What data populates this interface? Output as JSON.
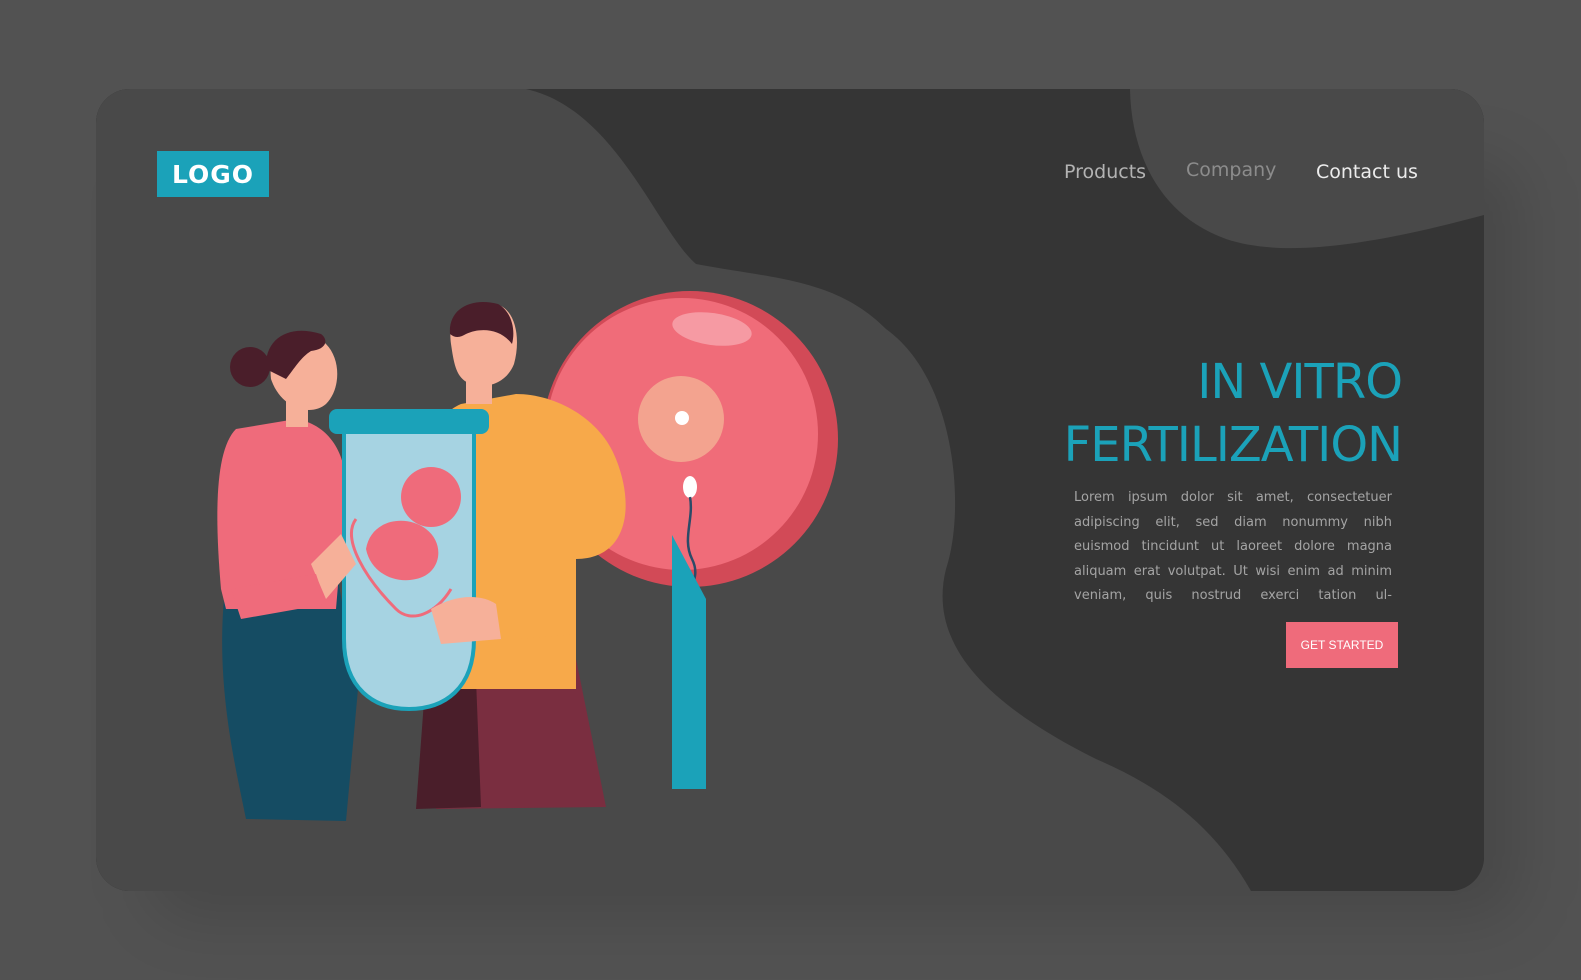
{
  "header": {
    "logo_text": "LOGO",
    "nav": {
      "products": "Products",
      "company": "Company",
      "contact": "Contact us"
    }
  },
  "hero": {
    "title_line1": "IN VITRO",
    "title_line2": "FERTILIZATION",
    "body": "Lorem ipsum dolor sit amet, consectetuer adipiscing elit, sed diam nonummy nibh euismod tincidunt ut laoreet dolore magna aliquam erat volutpat. Ut wisi enim ad minim veniam, quis nostrud exerci tation ul-",
    "cta_label": "GET STARTED"
  },
  "colors": {
    "accent_teal": "#1ba2b9",
    "cta_pink": "#ef6b7b",
    "card_dark": "#353535",
    "card_mid": "#494949",
    "page_bg": "#525252"
  },
  "icons": {
    "illustration": "ivf-couple-embryo-illustration"
  }
}
